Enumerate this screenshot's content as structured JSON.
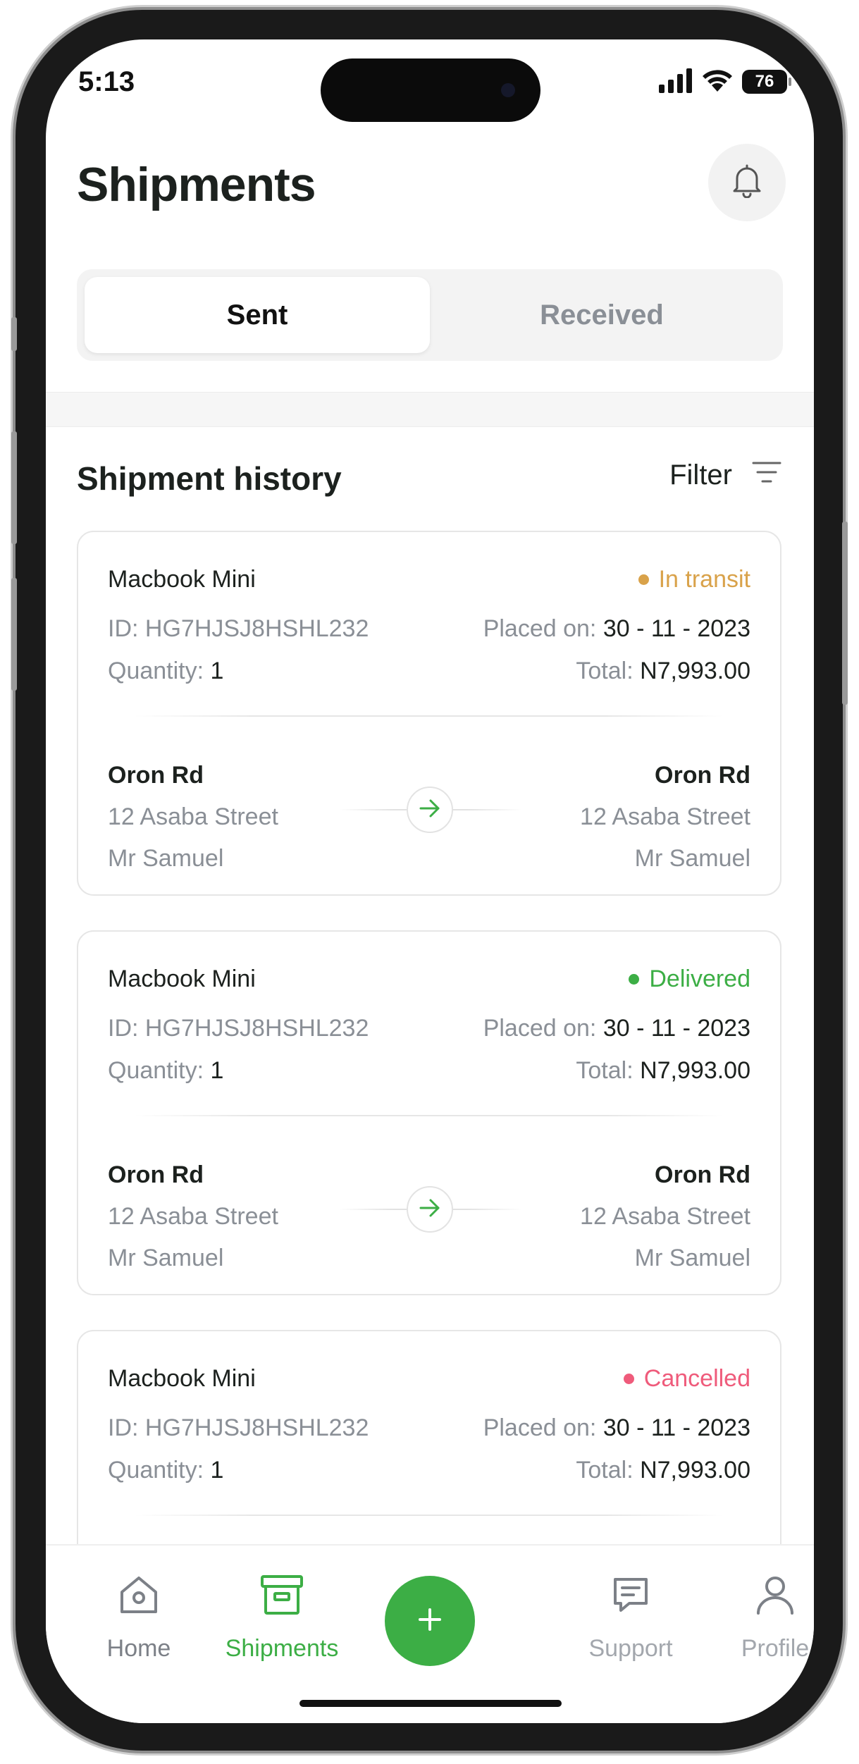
{
  "status_bar": {
    "time": "5:13",
    "battery": "76"
  },
  "header": {
    "title": "Shipments"
  },
  "tabs": [
    {
      "label": "Sent",
      "active": true
    },
    {
      "label": "Received",
      "active": false
    }
  ],
  "history": {
    "title": "Shipment history",
    "filter_label": "Filter"
  },
  "shipments": [
    {
      "item": "Macbook Mini",
      "status": "In transit",
      "status_color": "#d9a24a",
      "id_label": "ID:",
      "id": "HG7HJSJ8HSHL232",
      "placed_label": "Placed on:",
      "placed_date": "30 - 11 - 2023",
      "qty_label": "Quantity:",
      "qty": "1",
      "total_label": "Total:",
      "total": "N7,993.00",
      "from": {
        "name": "Oron Rd",
        "street": "12 Asaba Street",
        "person": "Mr Samuel"
      },
      "to": {
        "name": "Oron Rd",
        "street": "12 Asaba Street",
        "person": "Mr Samuel"
      }
    },
    {
      "item": "Macbook Mini",
      "status": "Delivered",
      "status_color": "#3cae45",
      "id_label": "ID:",
      "id": "HG7HJSJ8HSHL232",
      "placed_label": "Placed on:",
      "placed_date": "30 - 11 - 2023",
      "qty_label": "Quantity:",
      "qty": "1",
      "total_label": "Total:",
      "total": "N7,993.00",
      "from": {
        "name": "Oron Rd",
        "street": "12 Asaba Street",
        "person": "Mr Samuel"
      },
      "to": {
        "name": "Oron Rd",
        "street": "12 Asaba Street",
        "person": "Mr Samuel"
      }
    },
    {
      "item": "Macbook Mini",
      "status": "Cancelled",
      "status_color": "#ef5b7b",
      "id_label": "ID:",
      "id": "HG7HJSJ8HSHL232",
      "placed_label": "Placed on:",
      "placed_date": "30 - 11 - 2023",
      "qty_label": "Quantity:",
      "qty": "1",
      "total_label": "Total:",
      "total": "N7,993.00"
    }
  ],
  "nav": {
    "items": [
      {
        "label": "Home",
        "icon": "home-icon",
        "active": false
      },
      {
        "label": "Shipments",
        "icon": "box-icon",
        "active": true
      },
      {
        "label": "Support",
        "icon": "chat-icon",
        "active": false
      },
      {
        "label": "Profile",
        "icon": "user-icon",
        "active": false
      }
    ],
    "fab_icon": "plus-icon"
  },
  "colors": {
    "accent": "#3cae45",
    "text_dark": "#1c211e",
    "text_muted": "#8a8f96",
    "nav_inactive": "#7c8087",
    "nav_disabled": "#a3a7ad"
  }
}
